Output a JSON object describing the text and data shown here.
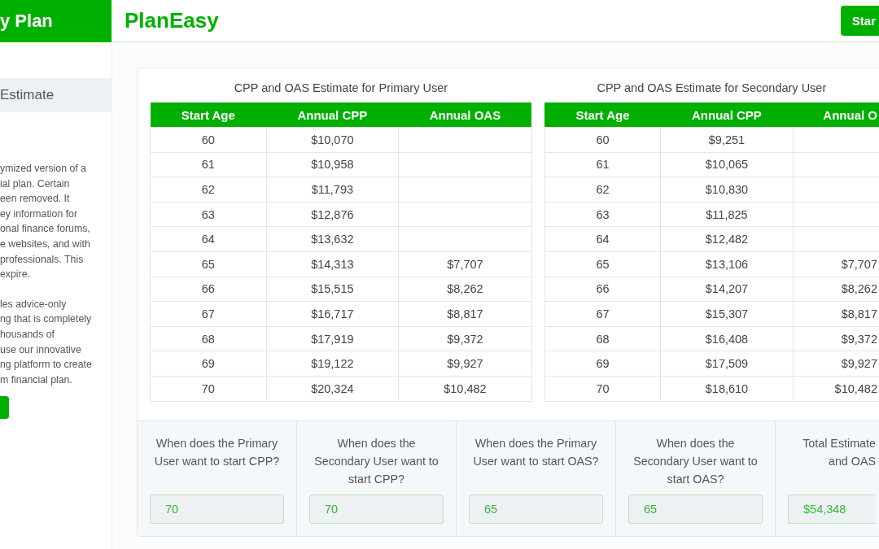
{
  "sidebar": {
    "brand": "y Plan",
    "items": [
      {
        "label": "Estimate",
        "selected": true
      }
    ],
    "paragraphs": [
      [
        "ymized version of a",
        "ial plan. Certain",
        "een removed. It",
        "ey information for",
        "onal finance forums,",
        "e websites, and with",
        "professionals. This",
        "expire."
      ],
      [
        "les advice-only",
        "ng that is completely",
        "housands of",
        "use our innovative",
        "ng platform to create",
        "m financial plan."
      ]
    ]
  },
  "header": {
    "logo": "PlanEasy",
    "button": "Star"
  },
  "tables": [
    {
      "title": "CPP and OAS Estimate for Primary User",
      "columns": [
        "Start Age",
        "Annual CPP",
        "Annual OAS"
      ],
      "rows": [
        {
          "age": "60",
          "cpp": "$10,070"
        },
        {
          "age": "61",
          "cpp": "$10,958"
        },
        {
          "age": "62",
          "cpp": "$11,793"
        },
        {
          "age": "63",
          "cpp": "$12,876"
        },
        {
          "age": "64",
          "cpp": "$13,632"
        },
        {
          "age": "65",
          "cpp": "$14,313",
          "oas": "$7,707"
        },
        {
          "age": "66",
          "cpp": "$15,515",
          "oas": "$8,262"
        },
        {
          "age": "67",
          "cpp": "$16,717",
          "oas": "$8,817"
        },
        {
          "age": "68",
          "cpp": "$17,919",
          "oas": "$9,372"
        },
        {
          "age": "69",
          "cpp": "$19,122",
          "oas": "$9,927"
        },
        {
          "age": "70",
          "cpp": "$20,324",
          "oas": "$10,482"
        }
      ]
    },
    {
      "title": "CPP and OAS Estimate for Secondary User",
      "columns": [
        "Start Age",
        "Annual CPP",
        "Annual O"
      ],
      "rows": [
        {
          "age": "60",
          "cpp": "$9,251"
        },
        {
          "age": "61",
          "cpp": "$10,065"
        },
        {
          "age": "62",
          "cpp": "$10,830"
        },
        {
          "age": "63",
          "cpp": "$11,825"
        },
        {
          "age": "64",
          "cpp": "$12,482"
        },
        {
          "age": "65",
          "cpp": "$13,106",
          "oas": "$7,707"
        },
        {
          "age": "66",
          "cpp": "$14,207",
          "oas": "$8,262"
        },
        {
          "age": "67",
          "cpp": "$15,307",
          "oas": "$8,817"
        },
        {
          "age": "68",
          "cpp": "$16,408",
          "oas": "$9,372"
        },
        {
          "age": "69",
          "cpp": "$17,509",
          "oas": "$9,927"
        },
        {
          "age": "70",
          "cpp": "$18,610",
          "oas": "$10,482"
        }
      ]
    }
  ],
  "questions": [
    {
      "label": "When does the Primary User want to start CPP?",
      "value": "70"
    },
    {
      "label": "When does the Secondary User want to start CPP?",
      "value": "70"
    },
    {
      "label": "When does the Primary User want to start OAS?",
      "value": "65"
    },
    {
      "label": "When does the Secondary User want to start OAS?",
      "value": "65"
    },
    {
      "label": "Total Estimate and OAS",
      "value": "$54,348"
    }
  ]
}
